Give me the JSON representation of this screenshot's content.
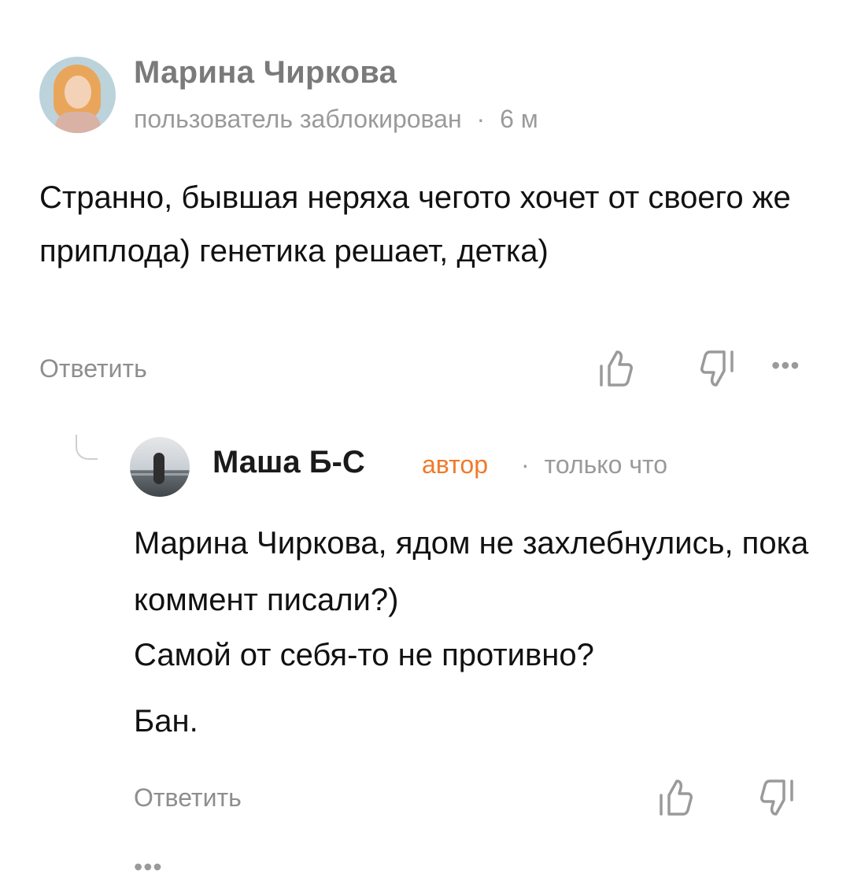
{
  "comment": {
    "author": "Марина Чиркова",
    "status": "пользователь заблокирован",
    "separator": "·",
    "time": "6 м",
    "text": "Странно, бывшая неряха чегото хочет от своего же приплода) генетика решает, детка)",
    "reply_label": "Ответить",
    "like_icon": "thumbs-up-icon",
    "dislike_icon": "thumbs-down-icon",
    "more_icon": "more-dots-icon",
    "more_label": "•••"
  },
  "reply": {
    "author": "Маша Б-С",
    "badge": "автор",
    "separator": "·",
    "time": "только что",
    "paragraphs": [
      "Марина Чиркова, ядом не захлебнулись, пока коммент писали?)",
      "Самой от себя-то не противно?",
      "Бан."
    ],
    "reply_label": "Ответить",
    "like_icon": "thumbs-up-icon",
    "dislike_icon": "thumbs-down-icon",
    "more_label": "•••"
  },
  "colors": {
    "accent": "#f07a2a",
    "muted": "#9a9a9a",
    "text": "#111111"
  }
}
